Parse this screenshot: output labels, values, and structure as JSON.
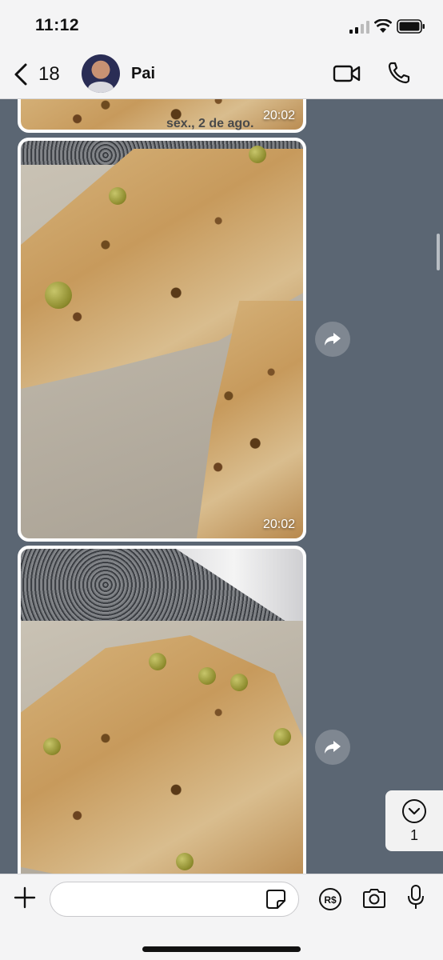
{
  "status_bar": {
    "time": "11:12"
  },
  "header": {
    "back_count": "18",
    "contact_name": "Pai"
  },
  "chat": {
    "date_separator": "sex., 2 de ago.",
    "messages": [
      {
        "type": "image",
        "time": "20:02"
      },
      {
        "type": "image",
        "time": "20:02"
      },
      {
        "type": "image",
        "time": ""
      }
    ],
    "unread_jump_count": "1"
  },
  "input_bar": {
    "message_value": "",
    "message_placeholder": ""
  },
  "icons": {
    "back": "chevron-left-icon",
    "video": "video-camera-icon",
    "call": "phone-icon",
    "forward": "forward-arrow-icon",
    "scroll_down": "chevron-down-circle-icon",
    "attach": "plus-icon",
    "sticker": "sticker-icon",
    "payment": "brl-payment-icon",
    "camera": "camera-icon",
    "microphone": "microphone-icon"
  },
  "colors": {
    "chat_background": "#5b6673",
    "bar_background": "#f4f4f5"
  }
}
